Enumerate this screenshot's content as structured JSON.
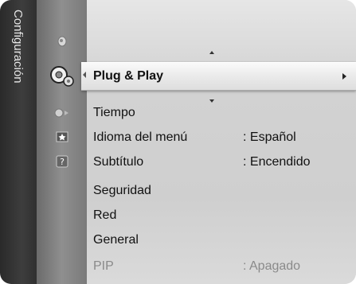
{
  "menu": {
    "title": "Configuración",
    "items": [
      {
        "label": "Plug & Play",
        "value": ""
      },
      {
        "label": "Tiempo",
        "value": ""
      },
      {
        "label": "Idioma del menú",
        "value": ": Español"
      },
      {
        "label": "Subtítulo",
        "value": ": Encendido"
      },
      {
        "label": "Seguridad",
        "value": ""
      },
      {
        "label": "Red",
        "value": ""
      },
      {
        "label": "General",
        "value": ""
      },
      {
        "label": "PIP",
        "value": ": Apagado"
      }
    ],
    "selected_index": 0,
    "disabled_index": 7
  },
  "icons": [
    {
      "name": "picture-icon"
    },
    {
      "name": "setup-icon"
    },
    {
      "name": "input-icon"
    },
    {
      "name": "application-icon"
    },
    {
      "name": "support-icon"
    }
  ]
}
